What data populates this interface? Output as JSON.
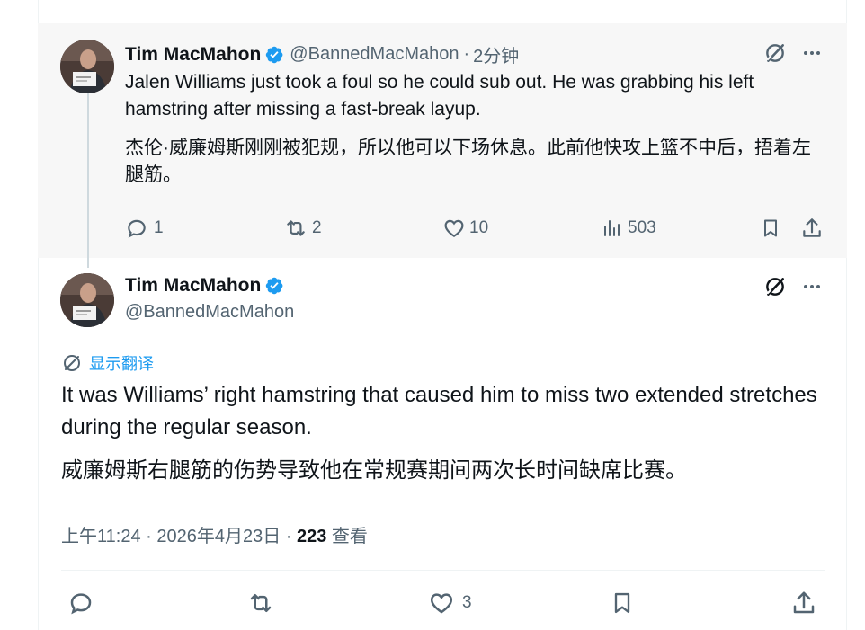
{
  "parent_tweet": {
    "author_name": "Tim MacMahon",
    "handle": "@BannedMacMahon",
    "separator": "·",
    "time": "2分钟",
    "text_en": "Jalen Williams just took a foul so he could sub out. He was grabbing his left hamstring after missing a fast-break layup.",
    "text_zh": "杰伦·威廉姆斯刚刚被犯规，所以他可以下场休息。此前他快攻上篮不中后，捂着左腿筋。",
    "stats": {
      "replies": "1",
      "retweets": "2",
      "likes": "10",
      "views": "503"
    }
  },
  "main_tweet": {
    "author_name": "Tim MacMahon",
    "handle": "@BannedMacMahon",
    "translate_label": "显示翻译",
    "text_en": "It was Williams’ right hamstring that caused him to miss two extended stretches during the regular season.",
    "text_zh": "威廉姆斯右腿筋的伤势导致他在常规赛期间两次长时间缺席比赛。",
    "timestamp": "上午11:24 · 2026年4月23日 · ",
    "view_count": "223",
    "views_label": " 查看",
    "stats": {
      "likes": "3"
    }
  },
  "colors": {
    "verified": "#1d9bf0",
    "link": "#1d9bf0",
    "muted": "#536471",
    "text": "#0f1419"
  },
  "icons": [
    "verified-badge-icon",
    "grok-icon",
    "more-icon",
    "reply-icon",
    "retweet-icon",
    "like-icon",
    "views-icon",
    "bookmark-icon",
    "share-icon",
    "translate-icon"
  ]
}
